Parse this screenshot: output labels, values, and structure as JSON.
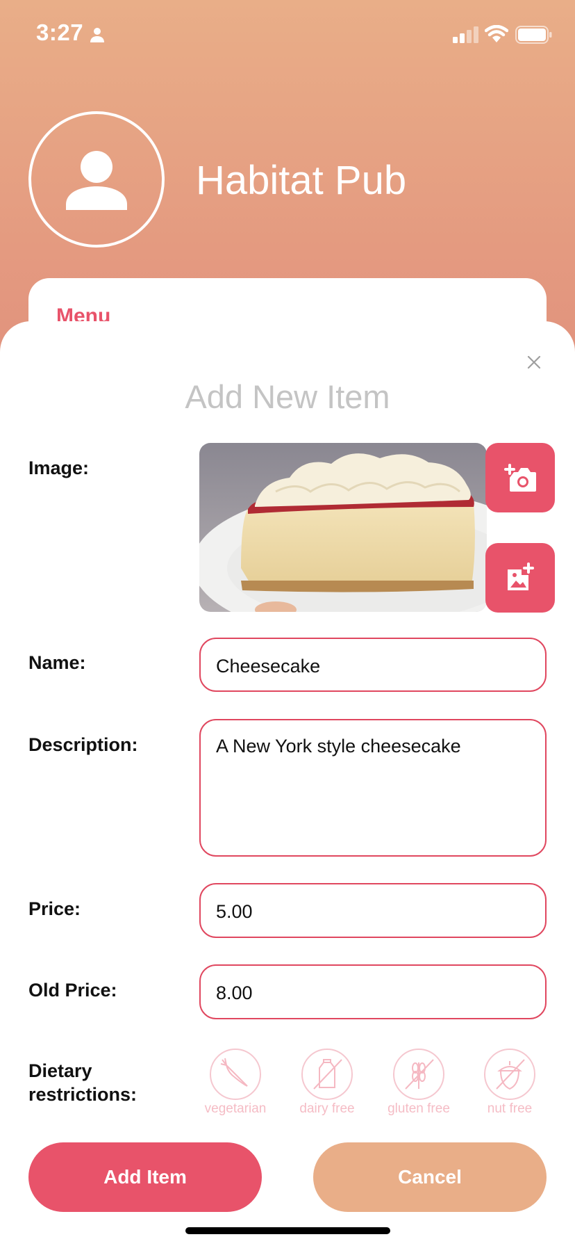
{
  "status_bar": {
    "time": "3:27"
  },
  "header": {
    "pub_name": "Habitat Pub",
    "menu_label": "Menu"
  },
  "sheet": {
    "title": "Add New Item"
  },
  "form": {
    "image_label": "Image:",
    "name_label": "Name:",
    "name_value": "Cheesecake",
    "description_label": "Description:",
    "description_value": "A New York style cheesecake",
    "price_label": "Price:",
    "price_value": "5.00",
    "old_price_label": "Old Price:",
    "old_price_value": "8.00",
    "dietary_label": "Dietary restrictions:",
    "dietary_options": [
      {
        "label": "vegetarian",
        "icon": "carrot-icon",
        "selected": false
      },
      {
        "label": "dairy free",
        "icon": "milk-carton-crossed-icon",
        "selected": false
      },
      {
        "label": "gluten free",
        "icon": "wheat-crossed-icon",
        "selected": false
      },
      {
        "label": "nut free",
        "icon": "acorn-crossed-icon",
        "selected": false
      }
    ]
  },
  "buttons": {
    "add": "Add Item",
    "cancel": "Cancel"
  },
  "colors": {
    "accent": "#e8536a",
    "secondary": "#e9ae88",
    "header_gradient_top": "#e9ae88",
    "header_gradient_bottom": "#e08f7c"
  }
}
